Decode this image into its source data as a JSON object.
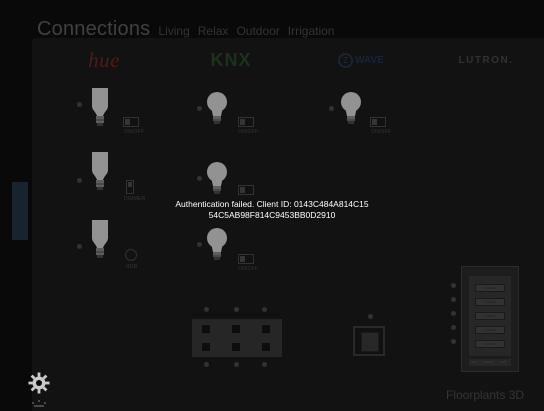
{
  "tabs": {
    "active": "Connections",
    "items": [
      "Living",
      "Relax",
      "Outdoor",
      "Irrigation"
    ]
  },
  "brands": {
    "hue": "hue",
    "knx": "KNX",
    "zwave": "WAVE",
    "zwave_z": "Z",
    "lutron": "LUTRON."
  },
  "controls": {
    "onoff": "ON/OFF",
    "dimmer": "DIMMER",
    "rgb": "RGB"
  },
  "keypad": {
    "buttons": [
      "SCENE 1",
      "SCENE 2",
      "SCENE 3",
      "SCENE 4",
      "SCENE 5"
    ],
    "foot": [
      "ON",
      "RAISE",
      "OFF"
    ]
  },
  "footer": {
    "app_name": "Floorplants 3D"
  },
  "toast": {
    "line1": "Authentication failed. Client ID: 0143C484A814C15",
    "line2": "54C5AB98F814C9453BB0D2910"
  },
  "icons": {
    "settings": "gear-icon",
    "bulb": "light-bulb-icon"
  },
  "colors": {
    "background": "#0b0b0b",
    "panel": "#151515",
    "hue_brand": "#5b1f1b",
    "knx_brand": "#1f3a1f",
    "zwave_brand": "#1d2a3e",
    "side_handle": "#1c2836",
    "toast_text": "#ffffff"
  }
}
